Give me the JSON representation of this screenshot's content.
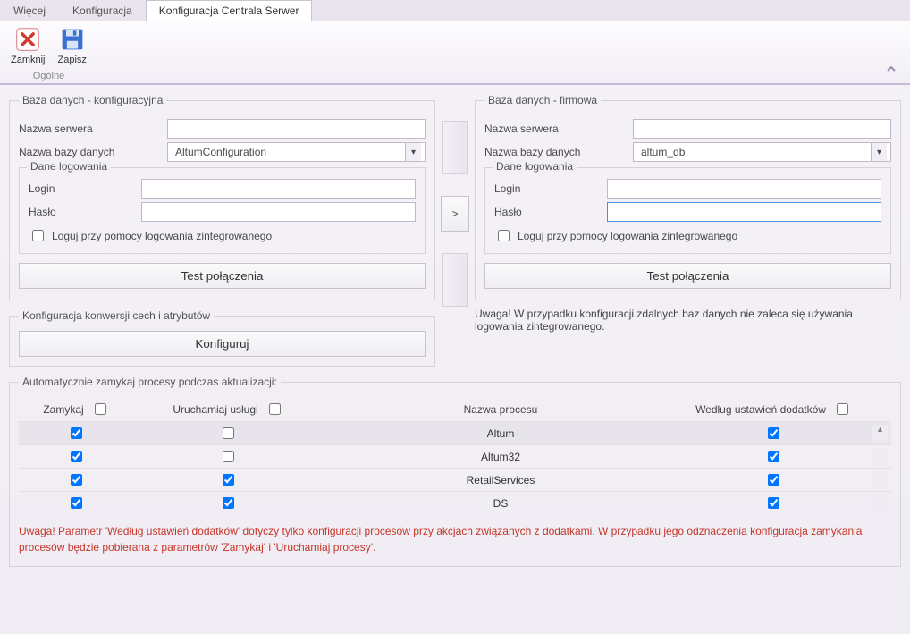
{
  "tabs": {
    "items": [
      "Więcej",
      "Konfiguracja",
      "Konfiguracja Centrala Serwer"
    ],
    "activeIndex": 2
  },
  "ribbon": {
    "close_label": "Zamknij",
    "save_label": "Zapisz",
    "group_label": "Ogólne"
  },
  "config_db": {
    "legend": "Baza danych - konfiguracyjna",
    "server_label": "Nazwa serwera",
    "server_value": "",
    "dbname_label": "Nazwa bazy danych",
    "dbname_value": "AltumConfiguration",
    "login_group": "Dane logowania",
    "login_label": "Login",
    "login_value": "",
    "password_label": "Hasło",
    "password_value": "",
    "integrated_label": "Loguj przy pomocy logowania zintegrowanego",
    "test_btn": "Test połączenia"
  },
  "company_db": {
    "legend": "Baza danych - firmowa",
    "server_label": "Nazwa serwera",
    "server_value": "",
    "dbname_label": "Nazwa bazy danych",
    "dbname_value": "altum_db",
    "login_group": "Dane logowania",
    "login_label": "Login",
    "login_value": "",
    "password_label": "Hasło",
    "password_value": "",
    "integrated_label": "Loguj przy pomocy logowania zintegrowanego",
    "test_btn": "Test połączenia",
    "note": "Uwaga! W przypadku konfiguracji zdalnych baz danych nie zaleca się używania logowania zintegrowanego."
  },
  "center": {
    "arrow": ">"
  },
  "attr_conv": {
    "legend": "Konfiguracja konwersji cech i atrybutów",
    "btn": "Konfiguruj"
  },
  "proc": {
    "legend": "Automatycznie zamykaj procesy podczas aktualizacji:",
    "headers": {
      "close": "Zamykaj",
      "startServices": "Uruchamiaj usługi",
      "procName": "Nazwa procesu",
      "addonSettings": "Według ustawień dodatków"
    },
    "rows": [
      {
        "close": true,
        "start": false,
        "name": "Altum",
        "addon": true,
        "alt": true
      },
      {
        "close": true,
        "start": false,
        "name": "Altum32",
        "addon": true,
        "alt": false
      },
      {
        "close": true,
        "start": true,
        "name": "RetailServices",
        "addon": true,
        "alt": false
      },
      {
        "close": true,
        "start": true,
        "name": "DS",
        "addon": true,
        "alt": false
      }
    ],
    "warning": "Uwaga! Parametr 'Według ustawień dodatków' dotyczy tylko konfiguracji procesów przy akcjach związanych z dodatkami. W przypadku jego odznaczenia konfiguracja zamykania procesów będzie pobierana z parametrów 'Zamykaj' i 'Uruchamiaj procesy'."
  }
}
